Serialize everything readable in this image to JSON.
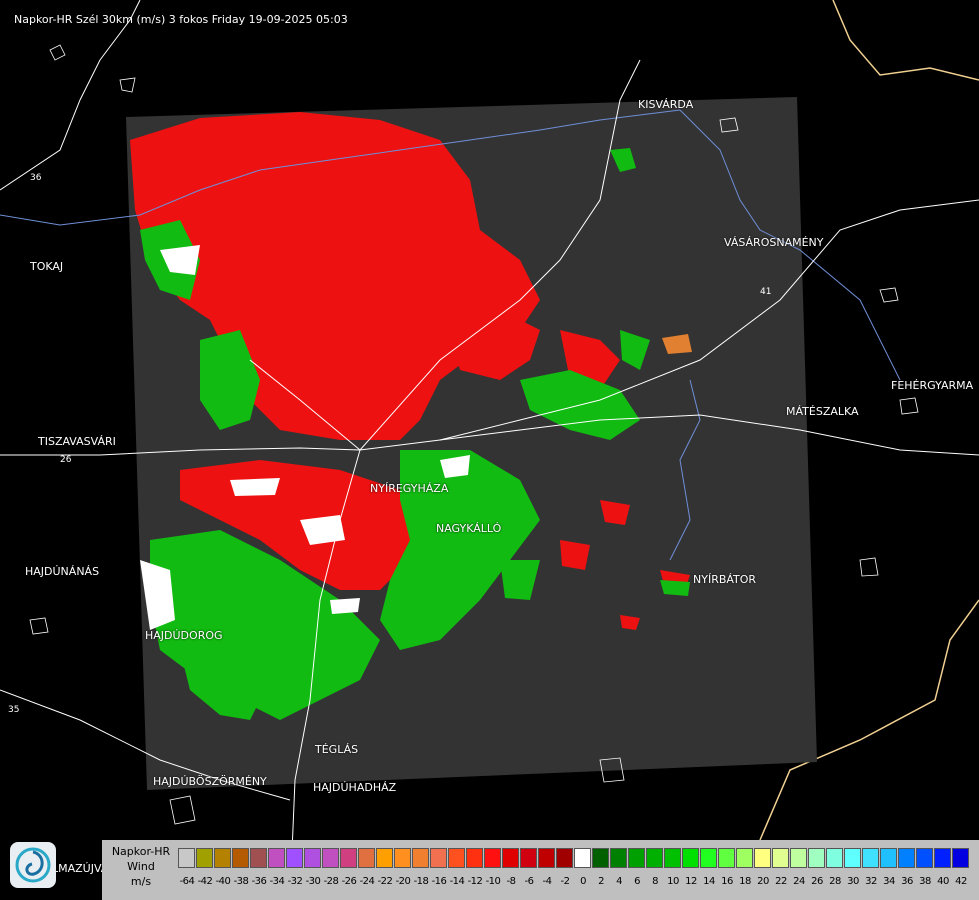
{
  "title": "Napkor-HR Szél 30km (m/s) 3 fokos Friday 19-09-2025 05:03",
  "cities": [
    {
      "id": "kisvarda",
      "name": "KISVÁRDA"
    },
    {
      "id": "tokaj",
      "name": "TOKAJ"
    },
    {
      "id": "vasarosnameny",
      "name": "VÁSÁROSNAMÉNY"
    },
    {
      "id": "fehergyarmat",
      "name": "FEHÉRGYARMA"
    },
    {
      "id": "mateszalka",
      "name": "MÁTÉSZALKA"
    },
    {
      "id": "tiszavasvari",
      "name": "TISZAVASVÁRI"
    },
    {
      "id": "nyiregyhaza",
      "name": "NYÍREGYHÁZA"
    },
    {
      "id": "nagykallo",
      "name": "NAGYKÁLLÓ"
    },
    {
      "id": "hajdunanas",
      "name": "HAJDÚNÁNÁS"
    },
    {
      "id": "nyirbator",
      "name": "NYÍRBÁTOR"
    },
    {
      "id": "hajdudorog",
      "name": "HAJDÚDOROG"
    },
    {
      "id": "teglas",
      "name": "TÉGLÁS"
    },
    {
      "id": "hajduboszormeny",
      "name": "HAJDÚBÖSZÖRMÉNY"
    },
    {
      "id": "hajduhadhaz",
      "name": "HAJDÚHADHÁZ"
    },
    {
      "id": "almazujvaros",
      "name": "LMAZÚJVÁR"
    }
  ],
  "road_numbers": [
    "36",
    "26",
    "41",
    "35"
  ],
  "legend": {
    "line1": "Napkor-HR",
    "line2": "Wind",
    "line3": "m/s",
    "ticks": [
      "-64",
      "-42",
      "-40",
      "-38",
      "-36",
      "-34",
      "-32",
      "-30",
      "-28",
      "-26",
      "-24",
      "-22",
      "-20",
      "-18",
      "-16",
      "-14",
      "-12",
      "-10",
      "-8",
      "-6",
      "-4",
      "-2",
      "0",
      "2",
      "4",
      "6",
      "8",
      "10",
      "12",
      "14",
      "16",
      "18",
      "20",
      "22",
      "24",
      "26",
      "28",
      "30",
      "32",
      "34",
      "36",
      "38",
      "40",
      "42"
    ],
    "colors": [
      "#c8c8c8",
      "#a0a000",
      "#b48200",
      "#b45a00",
      "#a05050",
      "#c050c0",
      "#a050ff",
      "#b050e0",
      "#c050c0",
      "#d04080",
      "#e07040",
      "#ffa000",
      "#ff9020",
      "#f08030",
      "#f07050",
      "#ff5020",
      "#ff3010",
      "#ff1010",
      "#e00000",
      "#d00010",
      "#c00000",
      "#a00000",
      "#ffffff",
      "#006000",
      "#008000",
      "#00a000",
      "#00b000",
      "#00c000",
      "#00e000",
      "#20ff20",
      "#60ff40",
      "#a0ff60",
      "#ffff80",
      "#e0ff90",
      "#c0ffa0",
      "#a0ffc0",
      "#80ffe0",
      "#60ffff",
      "#40e0ff",
      "#20c0ff",
      "#0080ff",
      "#0050ff",
      "#0020ff",
      "#0000e0"
    ]
  },
  "colors": {
    "radar_bg": "#333333",
    "inbound": "#ee1111",
    "outbound": "#11bb11",
    "border": "#f0d090",
    "river": "#6f8fd8"
  }
}
